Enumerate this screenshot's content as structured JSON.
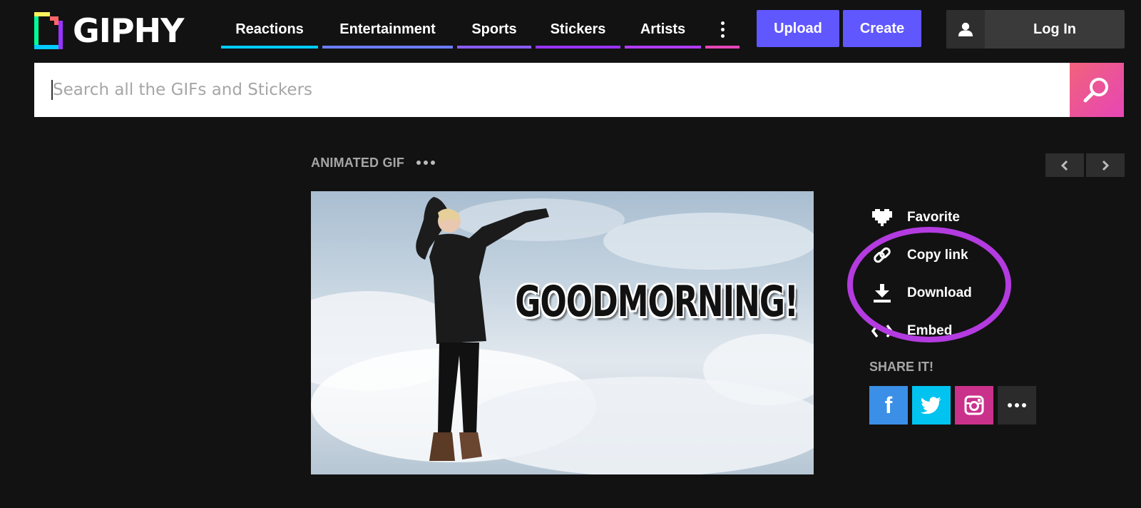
{
  "brand": {
    "name": "GIPHY"
  },
  "nav": {
    "items": [
      {
        "label": "Reactions",
        "color": "#00ccff"
      },
      {
        "label": "Entertainment",
        "color": "#6a7dff"
      },
      {
        "label": "Sports",
        "color": "#8a5cff"
      },
      {
        "label": "Stickers",
        "color": "#9933ff"
      },
      {
        "label": "Artists",
        "color": "#b13cff"
      }
    ],
    "more_color": "#e646b6"
  },
  "header": {
    "upload_label": "Upload",
    "create_label": "Create",
    "login_label": "Log In",
    "accent": "#6157ff"
  },
  "search": {
    "placeholder": "Search all the GIFs and Stickers"
  },
  "content": {
    "type_label": "ANIMATED GIF",
    "gif_caption": "GOODMORNING!",
    "actions": [
      {
        "label": "Favorite",
        "icon": "heart-icon"
      },
      {
        "label": "Copy link",
        "icon": "link-icon"
      },
      {
        "label": "Download",
        "icon": "download-icon"
      },
      {
        "label": "Embed",
        "icon": "code-icon"
      }
    ],
    "share_title": "SHARE IT!",
    "share": [
      {
        "name": "facebook",
        "color": "#3b8fe6",
        "glyph": "f"
      },
      {
        "name": "twitter",
        "color": "#00c3f0"
      },
      {
        "name": "instagram",
        "color": "#c9318b"
      },
      {
        "name": "more",
        "color": "#2b2b2b"
      }
    ],
    "highlight_color": "#b33be0"
  }
}
